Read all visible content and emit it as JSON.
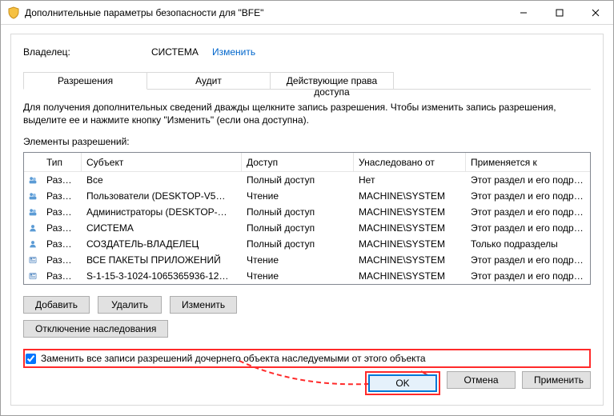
{
  "titlebar": {
    "title": "Дополнительные параметры безопасности  для \"BFE\""
  },
  "owner": {
    "label": "Владелец:",
    "value": "СИСТЕМА",
    "change_link": "Изменить"
  },
  "tabs": {
    "permissions": "Разрешения",
    "audit": "Аудит",
    "effective": "Действующие права доступа"
  },
  "hint": "Для получения дополнительных сведений дважды щелкните запись разрешения. Чтобы изменить запись разрешения, выделите ее и нажмите кнопку \"Изменить\" (если она доступна).",
  "section_label": "Элементы разрешений:",
  "columns": {
    "type": "Тип",
    "subject": "Субъект",
    "access": "Доступ",
    "inherited": "Унаследовано от",
    "applies": "Применяется к"
  },
  "rows": [
    {
      "icon": "group",
      "type": "Разр…",
      "subject": "Все",
      "access": "Полный доступ",
      "inherited": "Нет",
      "applies": "Этот раздел и его подразделы"
    },
    {
      "icon": "group",
      "type": "Разр…",
      "subject": "Пользователи (DESKTOP-V5…",
      "access": "Чтение",
      "inherited": "MACHINE\\SYSTEM",
      "applies": "Этот раздел и его подразделы"
    },
    {
      "icon": "group",
      "type": "Разр…",
      "subject": "Администраторы (DESKTOP-…",
      "access": "Полный доступ",
      "inherited": "MACHINE\\SYSTEM",
      "applies": "Этот раздел и его подразделы"
    },
    {
      "icon": "user",
      "type": "Разр…",
      "subject": "СИСТЕМА",
      "access": "Полный доступ",
      "inherited": "MACHINE\\SYSTEM",
      "applies": "Этот раздел и его подразделы"
    },
    {
      "icon": "user",
      "type": "Разр…",
      "subject": "СОЗДАТЕЛЬ-ВЛАДЕЛЕЦ",
      "access": "Полный доступ",
      "inherited": "MACHINE\\SYSTEM",
      "applies": "Только подразделы"
    },
    {
      "icon": "pkg",
      "type": "Разр…",
      "subject": "ВСЕ ПАКЕТЫ ПРИЛОЖЕНИЙ",
      "access": "Чтение",
      "inherited": "MACHINE\\SYSTEM",
      "applies": "Этот раздел и его подразделы"
    },
    {
      "icon": "pkg",
      "type": "Разр…",
      "subject": "S-1-15-3-1024-1065365936-12…",
      "access": "Чтение",
      "inherited": "MACHINE\\SYSTEM",
      "applies": "Этот раздел и его подразделы"
    }
  ],
  "buttons": {
    "add": "Добавить",
    "remove": "Удалить",
    "edit": "Изменить",
    "disable_inherit": "Отключение наследования",
    "ok": "OK",
    "cancel": "Отмена",
    "apply": "Применить"
  },
  "checkbox": {
    "label": "Заменить все записи разрешений дочернего объекта наследуемыми от этого объекта",
    "checked": true
  }
}
